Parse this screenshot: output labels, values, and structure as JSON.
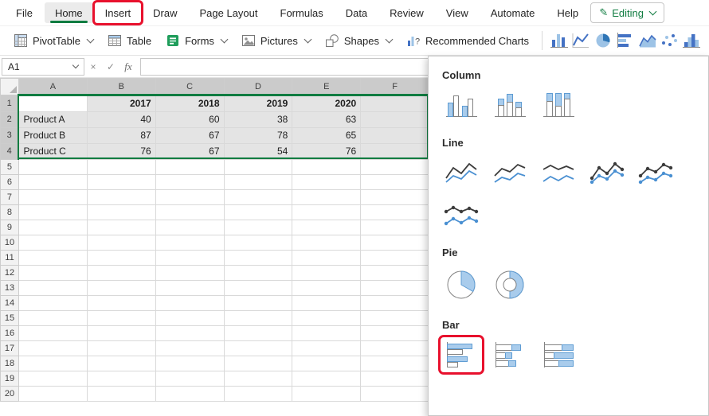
{
  "colors": {
    "accent_green": "#107C41",
    "annotation_red": "#E8112D",
    "icon_blue_fill": "#A9CCEC",
    "icon_blue_stroke": "#5E9CD3",
    "line_dark": "#3C3C3C",
    "line_blue": "#4A90D2",
    "toolbar_blue": "#4472C4",
    "toolbar_blue_light": "#9DC3E6",
    "selection_fill": "#E4E4E4"
  },
  "menu": {
    "tabs": [
      "File",
      "Home",
      "Insert",
      "Draw",
      "Page Layout",
      "Formulas",
      "Data",
      "Review",
      "View",
      "Automate",
      "Help"
    ],
    "active_tab": "Home",
    "annotated_tab": "Insert",
    "editing_label": "Editing"
  },
  "ribbon": {
    "pivottable_label": "PivotTable",
    "table_label": "Table",
    "forms_label": "Forms",
    "pictures_label": "Pictures",
    "shapes_label": "Shapes",
    "recommended_charts_label": "Recommended Charts",
    "chart_buttons": [
      "column-chart",
      "line-chart",
      "pie-chart",
      "bar-chart",
      "area-chart",
      "scatter-chart",
      "histogram-chart"
    ]
  },
  "formula_bar": {
    "name_box_value": "A1",
    "cancel_icon": "×",
    "enter_icon": "✓",
    "fx_label": "fx",
    "formula_value": ""
  },
  "sheet": {
    "columns": [
      "A",
      "B",
      "C",
      "D",
      "E",
      "F"
    ],
    "visible_rows": 20,
    "active_cell": "A1",
    "selection": "A1:F4",
    "selected_rows": [
      1,
      2,
      3,
      4
    ],
    "selected_columns": [
      "A",
      "B",
      "C",
      "D",
      "E",
      "F"
    ],
    "bold_rows": [
      1
    ],
    "cells": {
      "B1": "2017",
      "C1": "2018",
      "D1": "2019",
      "E1": "2020",
      "A2": "Product A",
      "B2": "40",
      "C2": "60",
      "D2": "38",
      "E2": "63",
      "A3": "Product B",
      "B3": "87",
      "C3": "67",
      "D3": "78",
      "E3": "65",
      "A4": "Product C",
      "B4": "76",
      "C4": "67",
      "D4": "54",
      "E4": "76"
    }
  },
  "chart_panel": {
    "sections": [
      {
        "title": "Column",
        "icons": [
          "clustered-column",
          "stacked-column",
          "100-stacked-column"
        ]
      },
      {
        "title": "Line",
        "icons": [
          "line",
          "stacked-line",
          "100-stacked-line",
          "line-with-markers",
          "stacked-line-with-markers",
          "100-stacked-line-with-markers"
        ]
      },
      {
        "title": "Pie",
        "icons": [
          "pie",
          "doughnut"
        ]
      },
      {
        "title": "Bar",
        "icons": [
          "clustered-bar",
          "stacked-bar",
          "100-stacked-bar"
        ]
      }
    ],
    "annotated_option": "clustered-bar"
  },
  "annotations": {
    "color": "#E8112D",
    "targets": [
      "insert-tab",
      "clustered-bar-option"
    ]
  }
}
